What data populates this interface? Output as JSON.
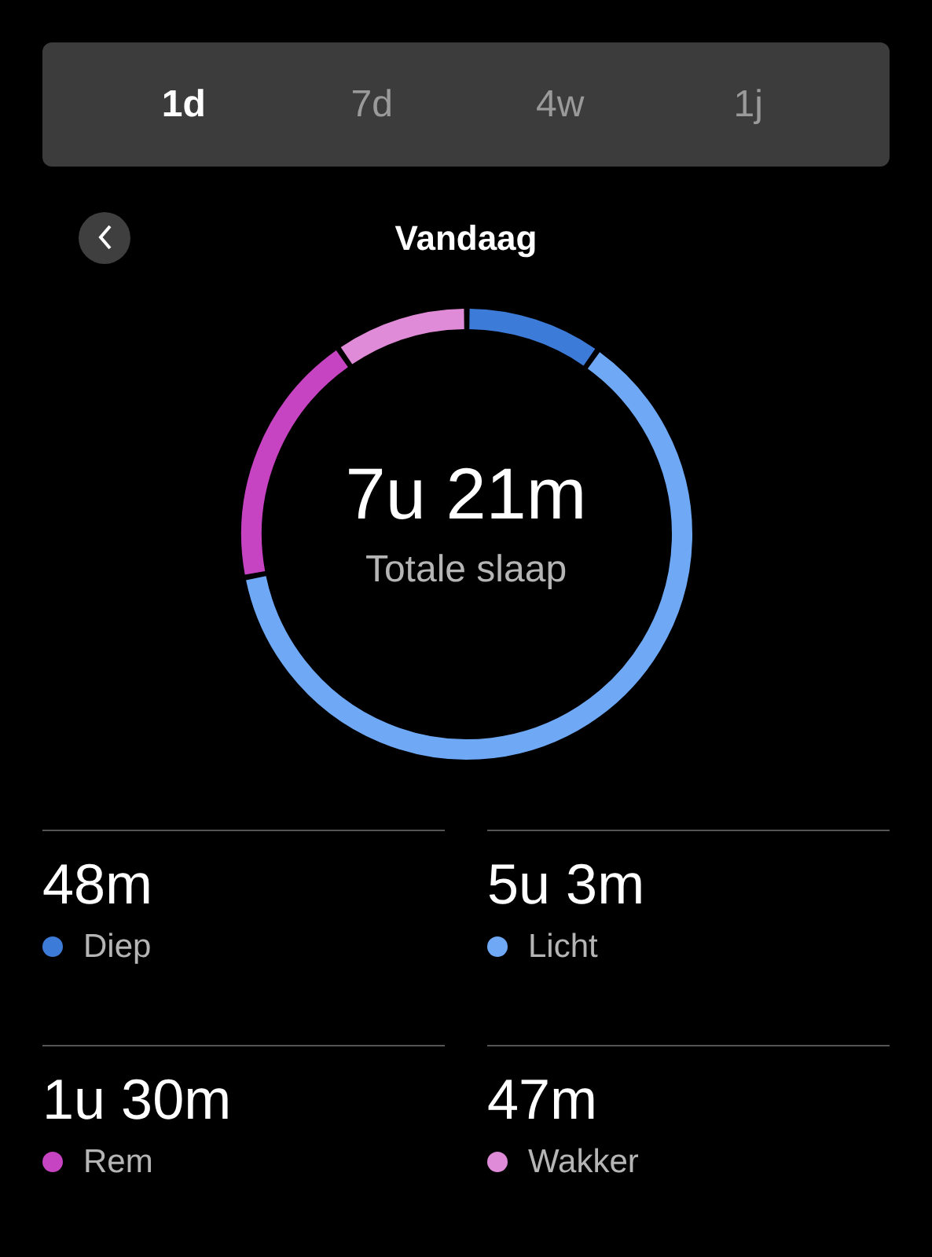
{
  "tabs": [
    {
      "label": "1d",
      "selected": true
    },
    {
      "label": "7d",
      "selected": false
    },
    {
      "label": "4w",
      "selected": false
    },
    {
      "label": "1j",
      "selected": false
    }
  ],
  "header": {
    "title": "Vandaag"
  },
  "summary": {
    "value": "7u 21m",
    "label": "Totale slaap"
  },
  "stages": [
    {
      "value": "48m",
      "label": "Diep",
      "color": "#3d7bd8"
    },
    {
      "value": "5u 3m",
      "label": "Licht",
      "color": "#6fa9f6"
    },
    {
      "value": "1u 30m",
      "label": "Rem",
      "color": "#c643c2"
    },
    {
      "value": "47m",
      "label": "Wakker",
      "color": "#e08bd8"
    }
  ]
}
